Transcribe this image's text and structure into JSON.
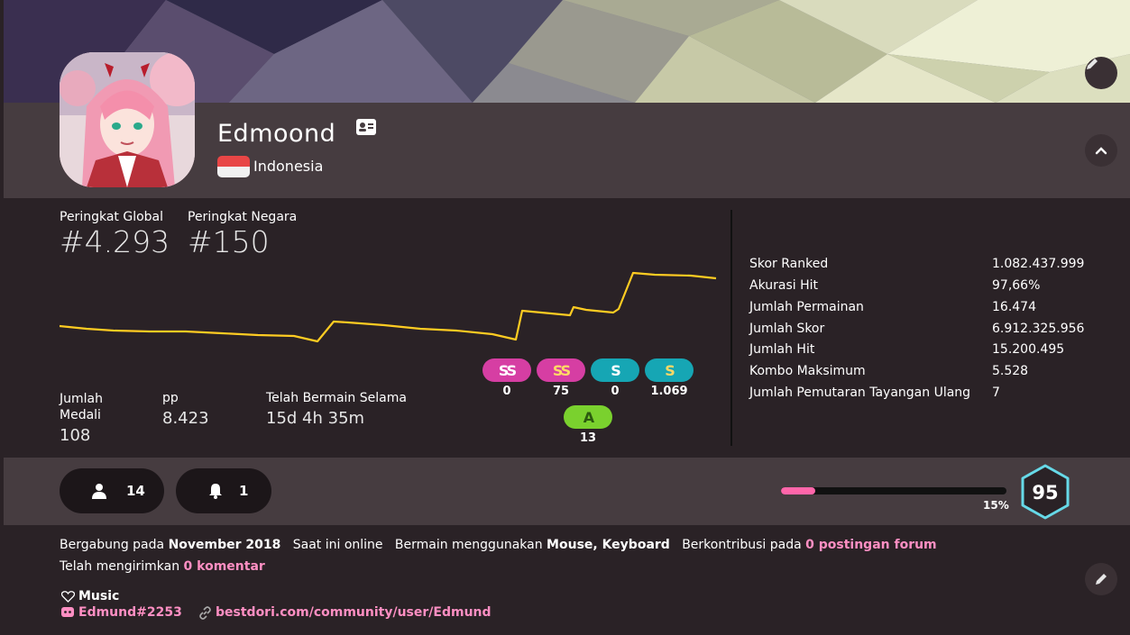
{
  "user": {
    "username": "Edmoond",
    "country": "Indonesia"
  },
  "ranks": {
    "global_label": "Peringkat Global",
    "global_value": "#4.293",
    "country_label": "Peringkat Negara",
    "country_value": "#150"
  },
  "summary": {
    "medals_label": "Jumlah Medali",
    "medals_value": "108",
    "pp_label": "pp",
    "pp_value": "8.423",
    "playtime_label": "Telah Bermain Selama",
    "playtime_value": "15d 4h 35m"
  },
  "grades": [
    {
      "label": "SS",
      "count": "0",
      "color": "#d63ea3",
      "text": "#ffffff"
    },
    {
      "label": "SS",
      "count": "75",
      "color": "#d63ea3",
      "text": "#ffd966"
    },
    {
      "label": "S",
      "count": "0",
      "color": "#16a6b4",
      "text": "#ffffff"
    },
    {
      "label": "S",
      "count": "1.069",
      "color": "#16a6b4",
      "text": "#ffd966"
    },
    {
      "label": "A",
      "count": "13",
      "color": "#7ad12e",
      "text": "#2b5a0f"
    }
  ],
  "stats": [
    {
      "key": "Skor Ranked",
      "value": "1.082.437.999"
    },
    {
      "key": "Akurasi Hit",
      "value": "97,66%"
    },
    {
      "key": "Jumlah Permainan",
      "value": "16.474"
    },
    {
      "key": "Jumlah Skor",
      "value": "6.912.325.956"
    },
    {
      "key": "Jumlah Hit",
      "value": "15.200.495"
    },
    {
      "key": "Kombo Maksimum",
      "value": "5.528"
    },
    {
      "key": "Jumlah Pemutaran Tayangan Ulang",
      "value": "7"
    }
  ],
  "social": {
    "followers": "14",
    "subscribers": "1"
  },
  "level": {
    "value": "95",
    "progress_label": "15%",
    "progress": 0.15,
    "bar_color": "#ff66aa",
    "badge_color": "#66d9e8"
  },
  "info": {
    "joined_prefix": "Bergabung pada",
    "joined_value": "November 2018",
    "online": "Saat ini online",
    "plays_with_prefix": "Bermain menggunakan",
    "plays_with_value": "Mouse, Keyboard",
    "contrib_prefix": "Berkontribusi pada",
    "contrib_value": "0 postingan forum",
    "comments_prefix": "Telah mengirimkan",
    "comments_value": "0 komentar",
    "interest": "Music",
    "discord": "Edmund#2253",
    "website": "bestdori.com/community/user/Edmund"
  },
  "icons": [
    "pencil-icon",
    "chevron-up-icon",
    "id-card-icon",
    "user-icon",
    "bell-icon",
    "heart-icon",
    "discord-icon",
    "link-icon"
  ],
  "accent_color": "#ff8fc3",
  "graph_color": "#ffcc22"
}
